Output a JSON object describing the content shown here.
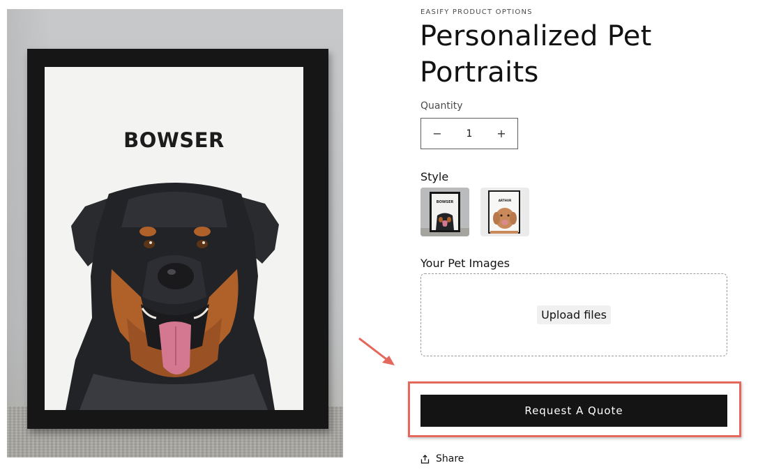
{
  "product": {
    "vendor": "EASIFY PRODUCT OPTIONS",
    "title": "Personalized Pet Portraits",
    "pet_name_on_portrait": "BOWSER"
  },
  "quantity": {
    "label": "Quantity",
    "value": "1",
    "decrease_symbol": "−",
    "increase_symbol": "+"
  },
  "style": {
    "label": "Style",
    "options": [
      {
        "name": "rottweiler-black-frame",
        "caption": "BOWSER",
        "selected": true
      },
      {
        "name": "doodle-black-frame",
        "caption": "ARTHUR",
        "selected": false
      }
    ]
  },
  "pet_images": {
    "label": "Your Pet Images",
    "upload_label": "Upload files"
  },
  "cta": {
    "label": "Request A Quote"
  },
  "share": {
    "label": "Share",
    "icon": "share-icon"
  },
  "annotation": {
    "highlight_color": "#e4685b",
    "arrow_icon": "arrow-pointer-icon"
  }
}
